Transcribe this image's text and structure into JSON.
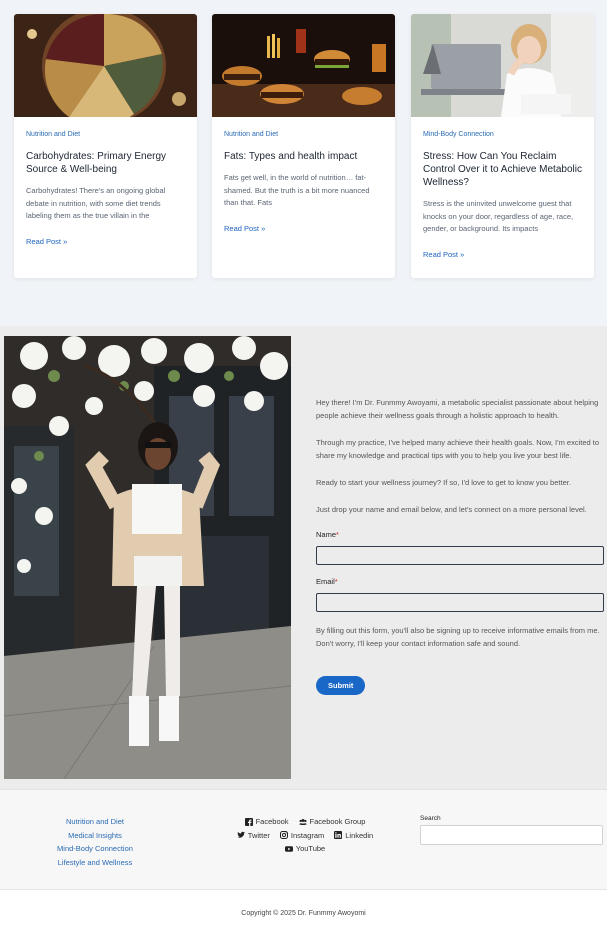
{
  "posts": [
    {
      "category": "Nutrition and Diet",
      "title": "Carbohydrates: Primary Energy Source & Well-being",
      "excerpt": "Carbohydrates! There's an ongoing global debate in nutrition, with some diet trends labeling them as the true villain in the",
      "read_more": "Read Post »"
    },
    {
      "category": "Nutrition and Diet",
      "title": "Fats: Types and health impact",
      "excerpt": "Fats get well, in the world of nutrition… fat-shamed. But the truth is a bit more nuanced than that. Fats",
      "read_more": "Read Post »"
    },
    {
      "category": "Mind-Body Connection",
      "title": "Stress: How Can You Reclaim Control Over it to Achieve Metabolic Wellness?",
      "excerpt": "Stress is the uninvited unwelcome guest that knocks on your door, regardless of age, race, gender, or background. Its impacts",
      "read_more": "Read Post »"
    }
  ],
  "contact": {
    "paragraphs": [
      "Hey there! I'm Dr. Funmmy Awoyami, a metabolic specialist passionate about helping people achieve their wellness goals through a holistic approach to health.",
      "Through my practice, I've helped many achieve their health goals. Now, I'm excited to share my knowledge and practical tips with you to help you live your best life.",
      "Ready to start your wellness journey? If so, I'd love to get to know you better.",
      "Just drop your name and email below, and let's connect on a more personal level."
    ],
    "name_label": "Name",
    "email_label": "Email",
    "required_mark": "*",
    "name_value": "",
    "email_value": "",
    "consent": "By filling out this form, you'll also be signing up to receive informative emails from me. Don't worry, I'll keep your contact information safe and sound.",
    "submit_label": "Submit"
  },
  "footer": {
    "links": [
      "Nutrition and Diet",
      "Medical Insights",
      "Mind-Body Connection",
      "Lifestyle and Wellness"
    ],
    "social": {
      "facebook": "Facebook",
      "facebook_group": "Facebook Group",
      "twitter": "Twitter",
      "instagram": "Instagram",
      "linkedin": "Linkedin",
      "youtube": "YouTube"
    },
    "search_label": "Search",
    "search_value": "",
    "copyright": "Copyright © 2025 Dr. Funmmy Awoyomi"
  },
  "colors": {
    "link_blue": "#1f64c0",
    "button_blue": "#1967c7",
    "section_gray": "#ececec",
    "posts_bg": "#f0f3f7"
  }
}
